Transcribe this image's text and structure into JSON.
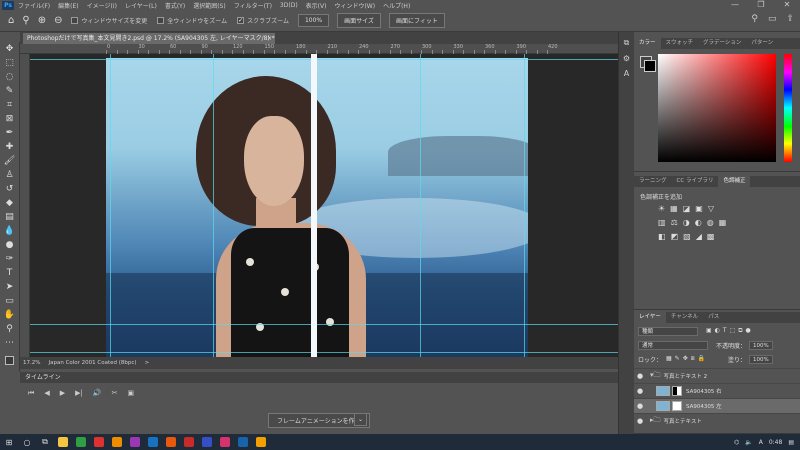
{
  "menu": {
    "logo": "Ps",
    "items": [
      "ファイル(F)",
      "編集(E)",
      "イメージ(I)",
      "レイヤー(L)",
      "書式(Y)",
      "選択範囲(S)",
      "フィルター(T)",
      "3D(D)",
      "表示(V)",
      "ウィンドウ(W)",
      "ヘルプ(H)"
    ],
    "window_controls": [
      "—",
      "❐",
      "✕"
    ]
  },
  "options": {
    "zoom_icon": "magnifier-icon",
    "resize_windows": "ウィンドウサイズを変更",
    "zoom_all": "全ウィンドウをズーム",
    "scrubby": "スクラブズーム",
    "zoom_value": "100%",
    "fit_screen": "画面サイズ",
    "fill_screen": "画面にフィット"
  },
  "document": {
    "tab_title": "Photoshopだけで写真集_本文見開き2.psd @ 17.2% (SA904305 左, レイヤーマスク/8) *",
    "close": "×"
  },
  "ruler": {
    "h_labels": [
      "0",
      "10",
      "20",
      "30",
      "40",
      "50",
      "60",
      "70",
      "80",
      "90",
      "100",
      "110",
      "120",
      "130",
      "140",
      "150",
      "160",
      "170",
      "180",
      "190",
      "200",
      "210",
      "220",
      "230",
      "240",
      "250",
      "260",
      "270",
      "280",
      "290",
      "300",
      "310",
      "320",
      "330",
      "340",
      "350",
      "360",
      "370",
      "380",
      "390",
      "400",
      "410",
      "420"
    ]
  },
  "status": {
    "zoom": "17.2%",
    "profile": "Japan Color 2001 Coated (8bpc)",
    "arrow": ">"
  },
  "timeline": {
    "title": "タイムライン",
    "create_button": "フレームアニメーションを作成",
    "dropdown": "⌄",
    "controls": [
      "⏮",
      "◀",
      "▶",
      "▶|",
      "🔊",
      "✂",
      "▣"
    ]
  },
  "panels": {
    "color_tabs": [
      "カラー",
      "スウォッチ",
      "グラデーション",
      "パターン"
    ],
    "adj_tabs": [
      "ラーニング",
      "CC ライブラリ",
      "色調補正"
    ],
    "adj_add": "色調補正を追加",
    "adj_row1": [
      "☀",
      "▦",
      "◪",
      "▣",
      "▽"
    ],
    "adj_row2": [
      "▥",
      "⚖",
      "◑",
      "◐",
      "◍",
      "▦"
    ],
    "adj_row3": [
      "◧",
      "◩",
      "▧",
      "◢",
      "▩"
    ],
    "layers_tabs": [
      "レイヤー",
      "チャンネル",
      "パス"
    ],
    "kind": "種類",
    "blend": "通常",
    "opacity_label": "不透明度：",
    "opacity": "100%",
    "lock_label": "ロック：",
    "fill_label": "塗り：",
    "fill": "100%",
    "layers": [
      {
        "name": "写真とテキスト 2",
        "type": "folder"
      },
      {
        "name": "SA904305 右",
        "type": "layer"
      },
      {
        "name": "SA904305 左",
        "type": "layer"
      },
      {
        "name": "写真とテキスト",
        "type": "folder"
      }
    ]
  },
  "taskbar": {
    "time": "0:48",
    "ime": "A"
  }
}
